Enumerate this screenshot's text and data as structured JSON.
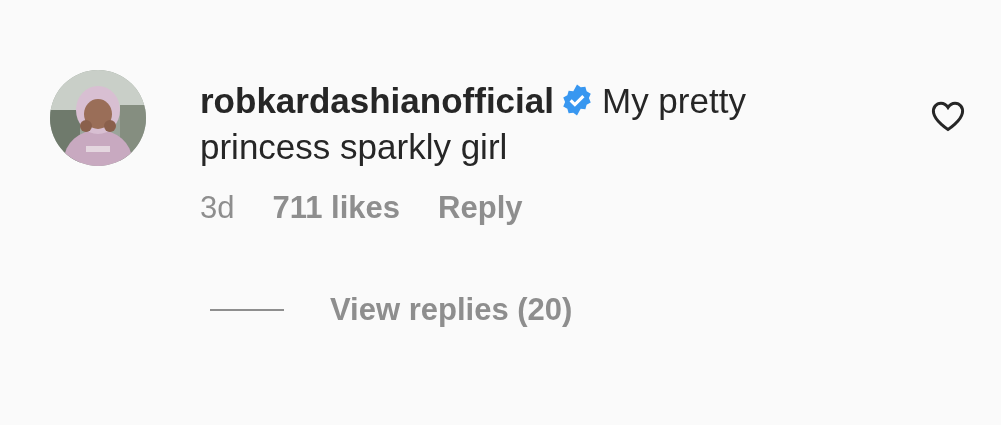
{
  "comment": {
    "username": "robkardashianofficial",
    "verified": true,
    "text": "My pretty princess sparkly girl",
    "liked": false,
    "time": "3d",
    "likes": "711 likes",
    "reply_label": "Reply"
  },
  "replies": {
    "label": "View replies (20)"
  }
}
